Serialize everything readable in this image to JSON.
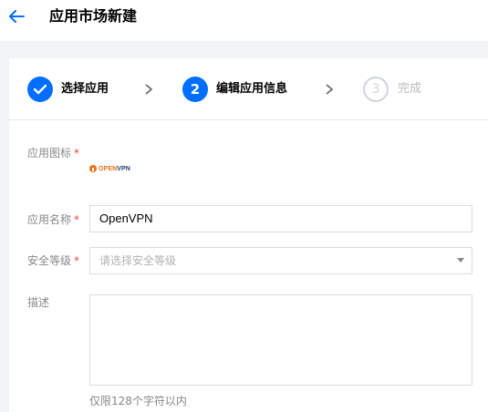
{
  "header": {
    "back_icon": "arrow-left-icon",
    "title": "应用市场新建"
  },
  "steps": [
    {
      "marker": "",
      "icon": "check-icon",
      "label": "选择应用",
      "state": "done"
    },
    {
      "marker": "2",
      "label": "编辑应用信息",
      "state": "active"
    },
    {
      "marker": "3",
      "label": "完成",
      "state": "todo"
    }
  ],
  "form": {
    "icon_field": {
      "label": "应用图标",
      "required_mark": "*",
      "logo_text_open": "OPEN",
      "logo_text_vpn": "VPN"
    },
    "name_field": {
      "label": "应用名称",
      "required_mark": "*",
      "value": "OpenVPN"
    },
    "security_field": {
      "label": "安全等级",
      "required_mark": "*",
      "placeholder": "请选择安全等级"
    },
    "description_field": {
      "label": "描述",
      "value": "",
      "hint": "仅限128个字符以内"
    }
  },
  "colors": {
    "accent": "#006eff",
    "required": "#e54545",
    "background": "#f3f4f7",
    "step_todo": "#cfd5de"
  }
}
